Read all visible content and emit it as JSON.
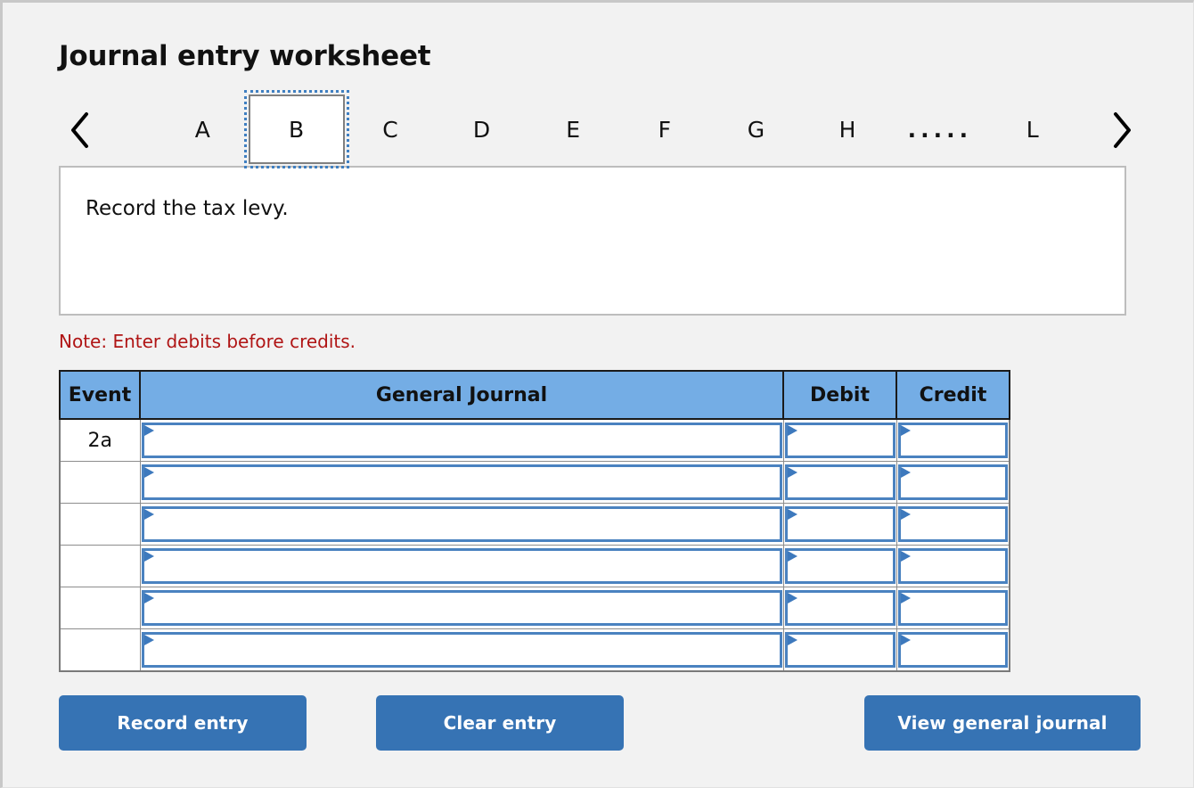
{
  "title": "Journal entry worksheet",
  "nav": {
    "prev_icon": "chevron-left-icon",
    "next_icon": "chevron-right-icon",
    "tabs": [
      {
        "label": "A",
        "selected": false
      },
      {
        "label": "B",
        "selected": true
      },
      {
        "label": "C",
        "selected": false
      },
      {
        "label": "D",
        "selected": false
      },
      {
        "label": "E",
        "selected": false
      },
      {
        "label": "F",
        "selected": false
      },
      {
        "label": "G",
        "selected": false
      },
      {
        "label": "H",
        "selected": false
      },
      {
        "label": ".....",
        "selected": false
      },
      {
        "label": "L",
        "selected": false
      }
    ]
  },
  "prompt": {
    "text": "Record the tax levy."
  },
  "note": "Note: Enter debits before credits.",
  "table": {
    "headers": {
      "event": "Event",
      "general_journal": "General Journal",
      "debit": "Debit",
      "credit": "Credit"
    },
    "rows": [
      {
        "event": "2a",
        "general_journal": "",
        "debit": "",
        "credit": ""
      },
      {
        "event": "",
        "general_journal": "",
        "debit": "",
        "credit": ""
      },
      {
        "event": "",
        "general_journal": "",
        "debit": "",
        "credit": ""
      },
      {
        "event": "",
        "general_journal": "",
        "debit": "",
        "credit": ""
      },
      {
        "event": "",
        "general_journal": "",
        "debit": "",
        "credit": ""
      },
      {
        "event": "",
        "general_journal": "",
        "debit": "",
        "credit": ""
      }
    ]
  },
  "buttons": {
    "record": "Record entry",
    "clear": "Clear entry",
    "view": "View general journal"
  },
  "colors": {
    "page_background": "#f2f2f2",
    "header_blue": "#74ade5",
    "button_blue": "#3673b4",
    "note_red": "#b01515",
    "field_border_blue": "#4a82c0",
    "panel_border_gray": "#bdbdbd"
  }
}
